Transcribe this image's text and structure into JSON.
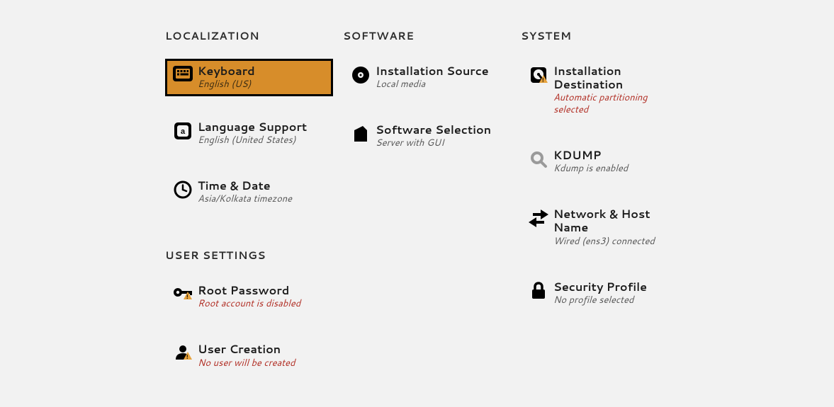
{
  "sections": {
    "localization": {
      "heading": "LOCALIZATION",
      "keyboard": {
        "title": "Keyboard",
        "status": "English (US)"
      },
      "language": {
        "title": "Language Support",
        "status": "English (United States)"
      },
      "time": {
        "title": "Time & Date",
        "status": "Asia/Kolkata timezone"
      }
    },
    "software": {
      "heading": "SOFTWARE",
      "source": {
        "title": "Installation Source",
        "status": "Local media"
      },
      "selection": {
        "title": "Software Selection",
        "status": "Server with GUI"
      }
    },
    "system": {
      "heading": "SYSTEM",
      "destination": {
        "title": "Installation Destination",
        "status": "Automatic partitioning selected"
      },
      "kdump": {
        "title": "KDUMP",
        "status": "Kdump is enabled"
      },
      "network": {
        "title": "Network & Host Name",
        "status": "Wired (ens3) connected"
      },
      "security": {
        "title": "Security Profile",
        "status": "No profile selected"
      }
    },
    "user": {
      "heading": "USER SETTINGS",
      "root": {
        "title": "Root Password",
        "status": "Root account is disabled"
      },
      "user": {
        "title": "User Creation",
        "status": "No user will be created"
      }
    }
  }
}
